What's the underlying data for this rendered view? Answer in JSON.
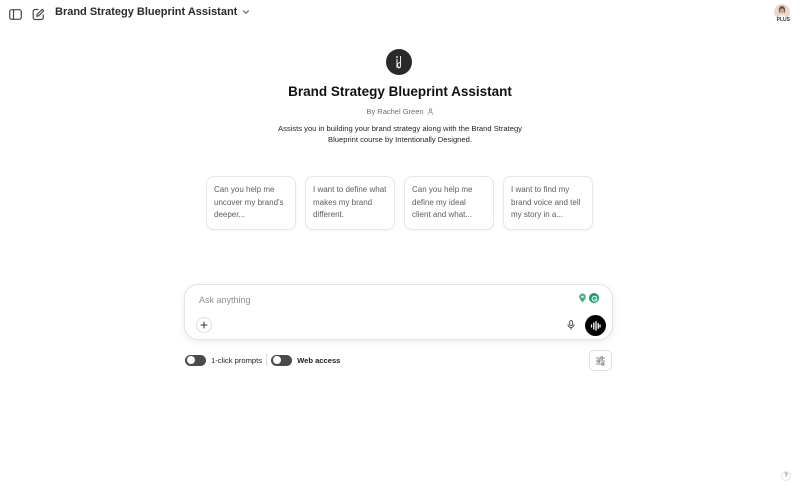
{
  "header": {
    "title": "Brand Strategy Blueprint Assistant",
    "sidebar_icon": "sidebar-toggle-icon",
    "new_chat_icon": "new-chat-icon",
    "plan_badge": "PLUS"
  },
  "gpt": {
    "name": "Brand Strategy Blueprint Assistant",
    "byline": "By Rachel Green",
    "description": "Assists you in building your brand strategy along with the Brand Strategy Blueprint course by Intentionally Designed."
  },
  "starters": [
    {
      "text": "Can you help me uncover my brand's deeper..."
    },
    {
      "text": "I want to define what makes my brand different."
    },
    {
      "text": "Can you help me define my ideal client and what..."
    },
    {
      "text": "I want to find my brand voice and tell my story in a..."
    }
  ],
  "composer": {
    "placeholder": "Ask anything"
  },
  "controls": {
    "one_click_label": "1-click prompts",
    "web_access_label": "Web access"
  },
  "help": {
    "label": "?"
  },
  "colors": {
    "accent": "#000000",
    "extension_green": "#2fa66a"
  }
}
